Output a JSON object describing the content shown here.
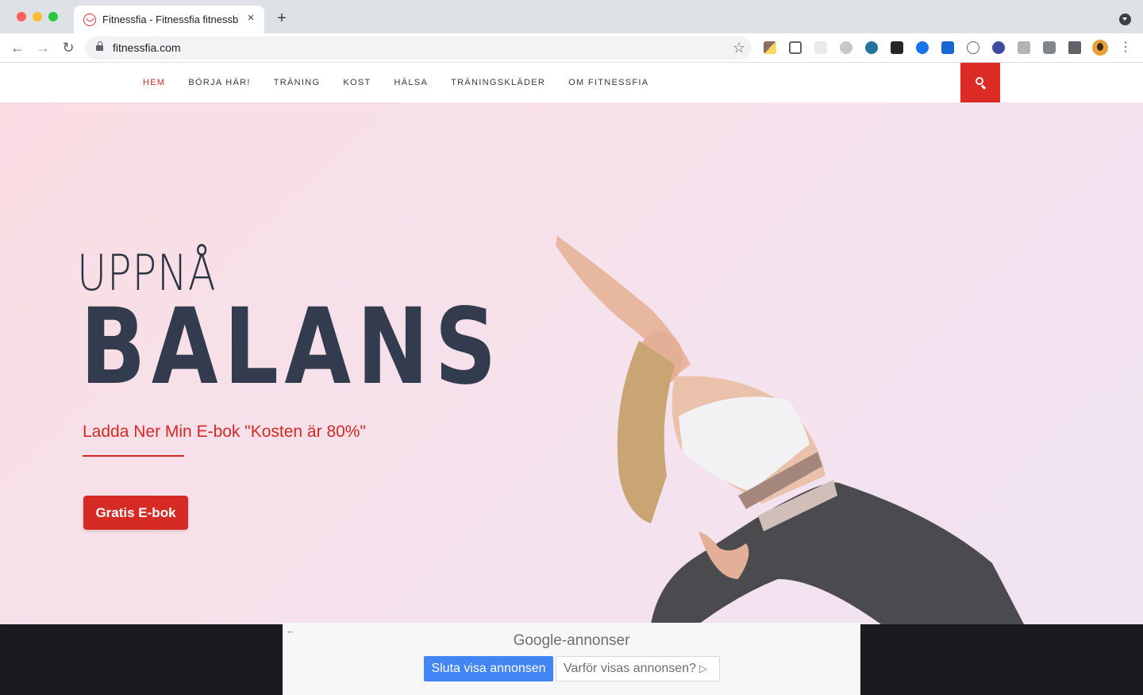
{
  "browser": {
    "tab_title": "Fitnessfia - Fitnessfia fitnessbl",
    "url": "fitnessfia.com",
    "new_tab": "+",
    "close_tab": "×"
  },
  "site": {
    "menu": [
      {
        "label": "HEM",
        "active": true
      },
      {
        "label": "BÖRJA HÄR!"
      },
      {
        "label": "TRÄNING"
      },
      {
        "label": "KOST"
      },
      {
        "label": "HÄLSA"
      },
      {
        "label": "TRÄNINGSKLÄDER"
      },
      {
        "label": "OM FITNESSFIA"
      }
    ],
    "accent_color": "#d42a25"
  },
  "hero": {
    "line1": "UPPNÅ",
    "line2": "BALANS",
    "subtitle": "Ladda Ner Min E-bok \"Kosten är 80%\"",
    "cta": "Gratis E-bok"
  },
  "ad": {
    "brand_google": "Google",
    "brand_suffix": "-annonser",
    "stop_button": "Sluta visa annonsen",
    "why_button": "Varför visas annonsen?"
  }
}
